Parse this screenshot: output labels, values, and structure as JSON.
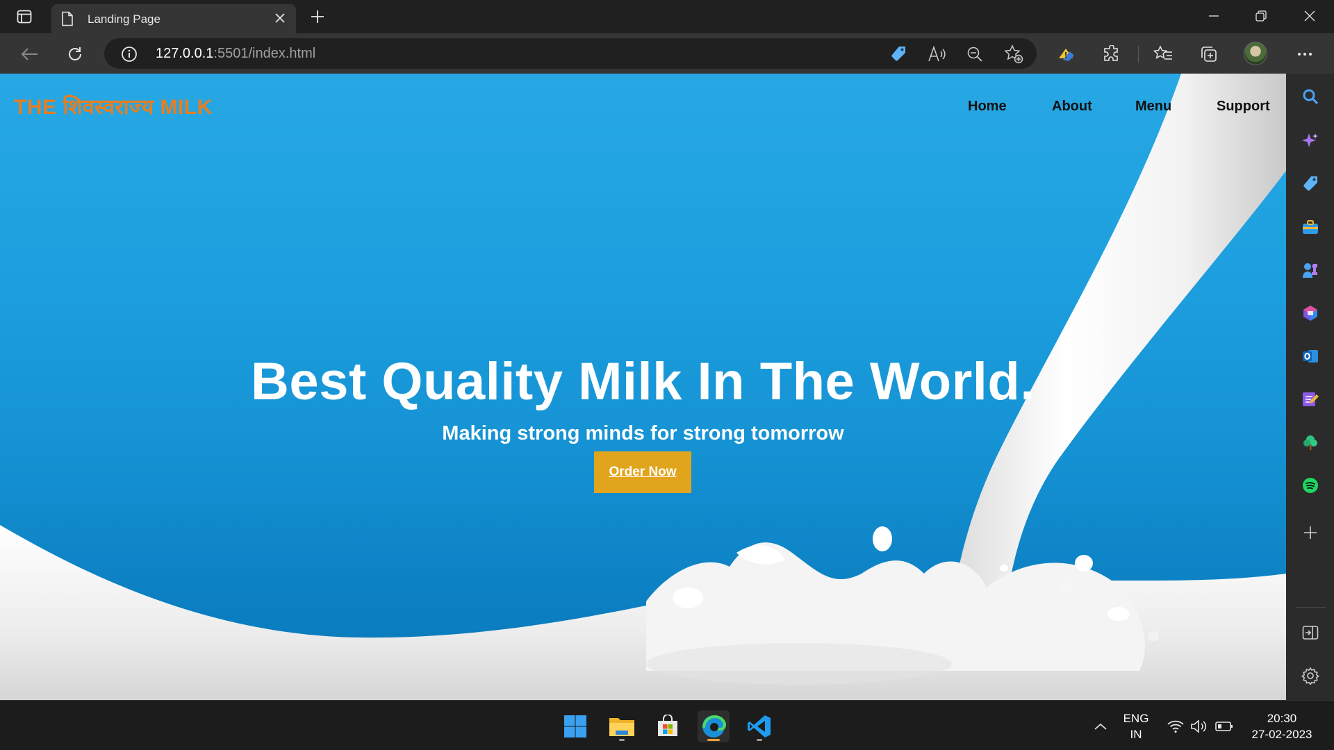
{
  "browser": {
    "tab_title": "Landing Page",
    "url_host": "127.0.0.1",
    "url_path": ":5501/index.html"
  },
  "site": {
    "logo": "THE शिवस्वराज्य MILK",
    "nav": [
      "Home",
      "About",
      "Menu",
      "Support"
    ],
    "hero_title": "Best Quality Milk In The World.",
    "hero_subtitle": "Making strong minds for strong tomorrow",
    "cta_label": "Order Now"
  },
  "taskbar": {
    "language_line1": "ENG",
    "language_line2": "IN",
    "time": "20:30",
    "date": "27-02-2023"
  },
  "colors": {
    "logo_orange": "#e67e22",
    "cta_gold": "#e0a51c",
    "hero_blue": "#1ea0e0"
  }
}
